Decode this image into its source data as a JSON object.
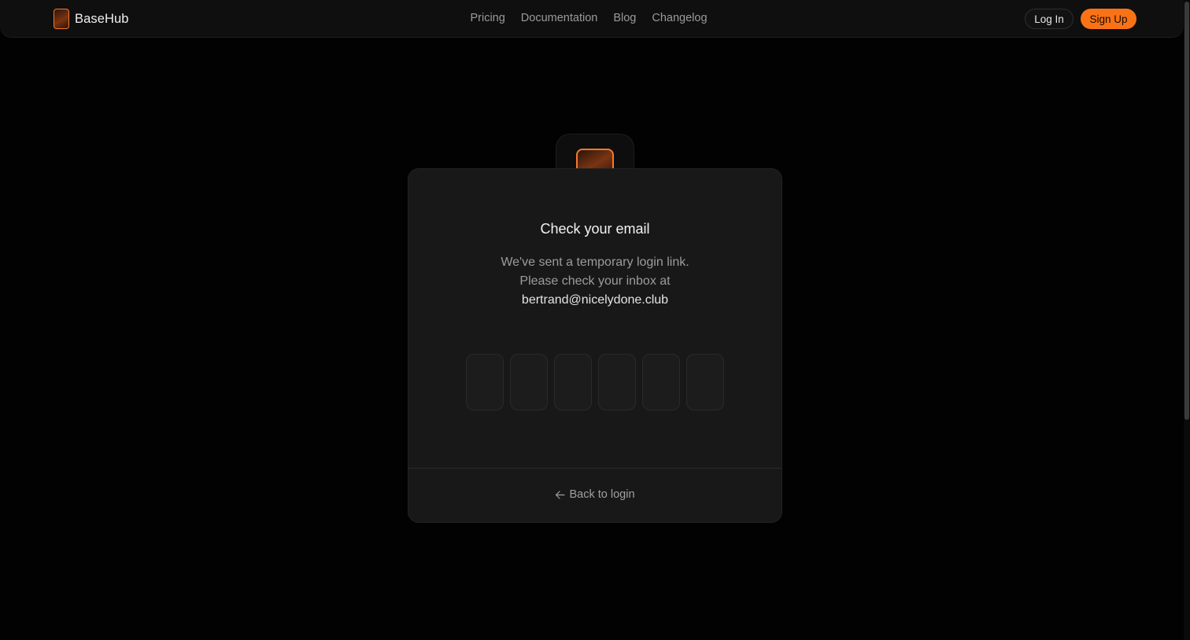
{
  "header": {
    "brand_name": "BaseHub",
    "nav": [
      {
        "label": "Pricing"
      },
      {
        "label": "Documentation"
      },
      {
        "label": "Blog"
      },
      {
        "label": "Changelog"
      }
    ],
    "login_label": "Log In",
    "signup_label": "Sign Up"
  },
  "card": {
    "title": "Check your email",
    "message_line1": "We've sent a temporary login link.",
    "message_line2": "Please check your inbox at",
    "email": "bertrand@nicelydone.club",
    "otp": [
      "",
      "",
      "",
      "",
      "",
      ""
    ],
    "back_label": "Back to login",
    "back_icon": "arrow-left-icon"
  },
  "colors": {
    "accent": "#f97316",
    "background": "#020202",
    "card": "#181818"
  }
}
